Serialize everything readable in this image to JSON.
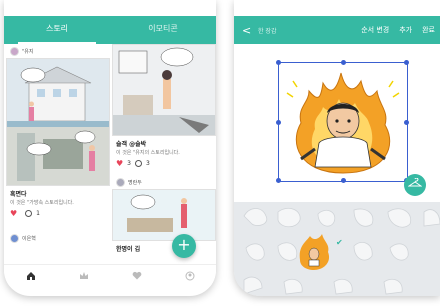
{
  "left_phone": {
    "tabs": [
      {
        "label": "스토리",
        "active": true
      },
      {
        "label": "이모티콘",
        "active": false
      }
    ],
    "posts": [
      {
        "author": "\"유지",
        "title": "",
        "desc": ""
      },
      {
        "author": "",
        "title": "흑면다",
        "desc": "이 것은 \"가방속 스토리입니다.",
        "likes": "",
        "comments": "1"
      },
      {
        "author": "",
        "title": "슬객 @슬박",
        "desc": "이 것은 \"유지의 스토리입니다.",
        "likes": "3",
        "comments": "3"
      },
      {
        "author": "명란두",
        "title": "",
        "desc": ""
      },
      {
        "author": "이은혁",
        "title": "",
        "desc": ""
      },
      {
        "author": "",
        "title": "한명이 김",
        "desc": ""
      }
    ],
    "fab_label": "+",
    "nav_icons": [
      "home-icon",
      "crown-icon",
      "heart-icon",
      "profile-icon"
    ]
  },
  "right_phone": {
    "back_label": "<",
    "title": "한 장감",
    "actions": [
      "순서 변경",
      "추가",
      "완료"
    ],
    "trash_icon": "hanger-icon"
  },
  "colors": {
    "accent": "#36b9a3",
    "like": "#e8455a",
    "selection": "#3a5fd0",
    "flame": "#f3a126"
  }
}
